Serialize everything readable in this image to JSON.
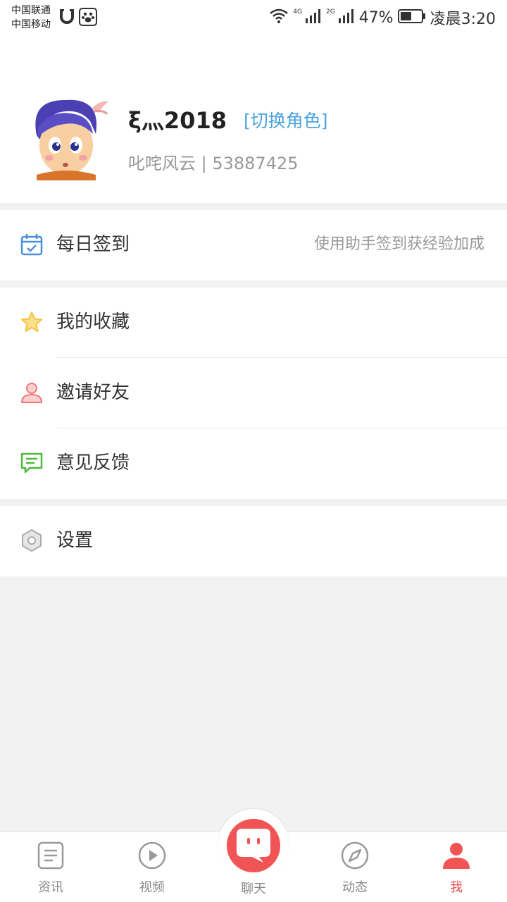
{
  "status_bar": {
    "carrier1": "中国联通",
    "carrier2": "中国移动",
    "net1": "4G",
    "net2": "2G",
    "battery": "47%",
    "time": "凌晨3:20"
  },
  "profile": {
    "name": "ξ灬2018",
    "switch_role": "[切换角色]",
    "server_info": "叱咤风云 | 53887425"
  },
  "menu": {
    "checkin": {
      "label": "每日签到",
      "hint": "使用助手签到获经验加成"
    },
    "favorites": {
      "label": "我的收藏"
    },
    "invite": {
      "label": "邀请好友"
    },
    "feedback": {
      "label": "意见反馈"
    },
    "settings": {
      "label": "设置"
    }
  },
  "bottom_nav": {
    "items": [
      {
        "label": "资讯",
        "icon": "news-icon"
      },
      {
        "label": "视频",
        "icon": "video-icon"
      },
      {
        "label": "聊天",
        "icon": "chat-icon"
      },
      {
        "label": "动态",
        "icon": "compass-icon"
      },
      {
        "label": "我",
        "icon": "person-icon"
      }
    ],
    "active_index": 4
  },
  "colors": {
    "accent": "#f05454",
    "link": "#4aa3df",
    "checkin_icon": "#4a90d9",
    "favorites_icon": "#f5c242",
    "invite_icon": "#f07a7a",
    "feedback_icon": "#4cbb3a",
    "settings_icon": "#aaaaaa"
  }
}
